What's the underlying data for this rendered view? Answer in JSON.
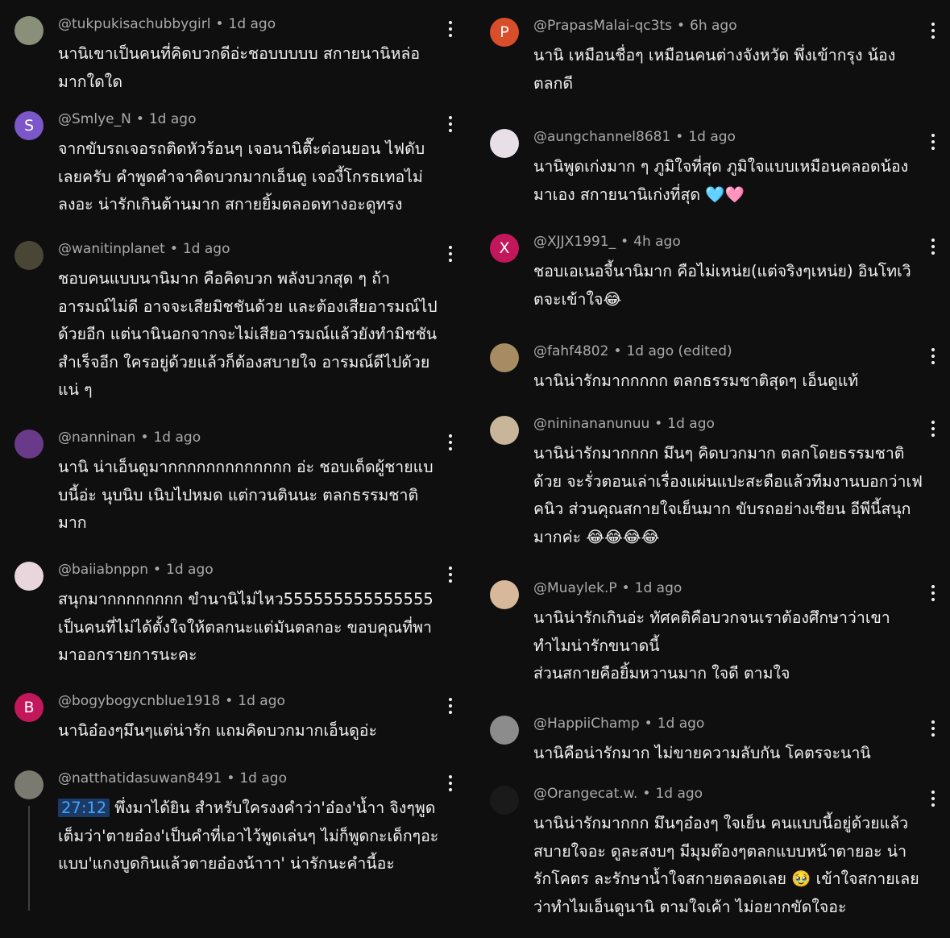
{
  "left": [
    {
      "handle": "@tukpukisachubbygirl",
      "time": "1d ago",
      "avatar": {
        "type": "image",
        "color": "#8a8f7a"
      },
      "text": "นานิเขาเป็นคนที่คิดบวกดีอ่ะชอบบบบบ สกายนานิหล่อมากใดใด"
    },
    {
      "handle": "@Smlye_N",
      "time": "1d ago",
      "avatar": {
        "type": "letter",
        "letter": "S",
        "color": "#7b57c9"
      },
      "text": "จากขับรถเจอรถติดหัวร้อนๆ เจอนานิตื๊ะต่อนยอน ไฟดับเลยครับ คำพูดคำจาคิดบวกมากเอ็นดู เจองี้โกรธเทอไม่ลงอะ น่ารักเกินต้านมาก สกายยิ้มตลอดทางอะดูทรง"
    },
    {
      "handle": "@wanitinplanet",
      "time": "1d ago",
      "avatar": {
        "type": "image",
        "color": "#4a4636"
      },
      "text": "ชอบคนแบบนานิมาก คือคิดบวก พลังบวกสุด ๆ ถ้าอารมณ์ไม่ดี อาจจะเสียมิชชันด้วย และต้องเสียอารมณ์ไปด้วยอีก แต่นานินอกจากจะไม่เสียอารมณ์แล้วยังทำมิชชันสำเร็จอีก ใครอยู่ด้วยแล้วก็ต้องสบายใจ อารมณ์ดีไปด้วยแน่ ๆ"
    },
    {
      "handle": "@nanninan",
      "time": "1d ago",
      "avatar": {
        "type": "image",
        "color": "#6a3a8a"
      },
      "text": "นานิ น่าเอ็นดูมากกกกกกกกกกกกก อ่ะ ชอบเด็ดผู้ชายแบบนี้อ่ะ นุบนิบ เนิบไปหมด แต่กวนตินนะ ตลกธรรมชาติมาก"
    },
    {
      "handle": "@baiiabnppn",
      "time": "1d ago",
      "avatar": {
        "type": "image",
        "color": "#e8d6dc"
      },
      "text": "สนุกมากกกกกกกก ขำนานิไม่ไหว555555555555555 เป็นคนที่ไม่ได้ตั้งใจให้ตลกนะแต่มันตลกอะ ขอบคุณที่พามาออกรายการนะคะ"
    },
    {
      "handle": "@bogybogycnblue1918",
      "time": "1d ago",
      "avatar": {
        "type": "letter",
        "letter": "B",
        "color": "#c2185b"
      },
      "text": "นานิอ๋องๆมึนๆแต่น่ารัก แถมคิดบวกมากเอ็นดูอ่ะ"
    },
    {
      "handle": "@natthatidasuwan8491",
      "time": "1d ago",
      "avatar": {
        "type": "image",
        "color": "#7a7a70"
      },
      "timestamp": "27:12",
      "text": "พึ่งมาได้ยิน สำหรับใครงงคำว่า'อ๋อง'น้ำา จิงๆพูดเต็มว่า'ตายอ๋อง'เป็นคำที่เอาไว้พูดเล่นๆ ไม่ก็พูดกะเด็กๆอะแบบ'แกงบูดกินแล้วตายอ๋องน้าาา' น่ารักนะคำนี้อะ"
    }
  ],
  "right": [
    {
      "handle": "@PrapasMalai-qc3ts",
      "time": "6h ago",
      "avatar": {
        "type": "letter",
        "letter": "P",
        "color": "#d84e2b"
      },
      "text": "นานิ เหมือนชื่อๆ เหมือนคนต่างจังหวัด พึ่งเข้ากรุง  น้องตลกดี"
    },
    {
      "handle": "@aungchannel8681",
      "time": "1d ago",
      "avatar": {
        "type": "image",
        "color": "#e8e0e6"
      },
      "text": "นานิพูดเก่งมาก ๆ ภูมิใจที่สุด ภูมิใจแบบเหมือนคลอดน้องมาเอง สกายนานิเก่งที่สุด 🩵🩷"
    },
    {
      "handle": "@XJJX1991_",
      "time": "4h ago",
      "avatar": {
        "type": "letter",
        "letter": "X",
        "color": "#c2185b"
      },
      "text": "ชอบเอเนอจี้นานิมาก คือไม่เหน่ย(แต่จริงๆเหน่ย) อินโทเวิตจะเข้าใจ😂"
    },
    {
      "handle": "@fahf4802",
      "time": "1d ago (edited)",
      "avatar": {
        "type": "image",
        "color": "#a68b63"
      },
      "text": "นานิน่ารักมากกกกก ตลกธรรมชาติสุดๆ เอ็นดูแท้"
    },
    {
      "handle": "@nininananunuu",
      "time": "1d ago",
      "avatar": {
        "type": "image",
        "color": "#c9b59a"
      },
      "text": "นานิน่ารักมากกกก มึนๆ คิดบวกมาก ตลกโดยธรรมชาติด้วย จะรั่วตอนเล่าเรื่องแผ่นแปะสะดือแล้วทีมงานบอกว่าเฟคนิว ส่วนคุณสกายใจเย็นมาก ขับรถอย่างเซียน อีพีนี้สนุกมากค่ะ 😂😂😂😂"
    },
    {
      "handle": "@Muaylek.P",
      "time": "1d ago",
      "avatar": {
        "type": "image",
        "color": "#d8b89a"
      },
      "text": "นานิน่ารักเกินอ่ะ ทัศคติคือบวกจนเราต้องศึกษาว่าเขาทำไมน่ารักขนาดนี้\nส่วนสกายคือยิ้มหวานมาก ใจดี ตามใจ"
    },
    {
      "handle": "@HappiiChamp",
      "time": "1d ago",
      "avatar": {
        "type": "image",
        "color": "#8c8c8c"
      },
      "text": "นานิคือน่ารักมาก ไม่ขายความลับกัน โคตรจะนานิ"
    },
    {
      "handle": "@Orangecat.w.",
      "time": "1d ago",
      "avatar": {
        "type": "image",
        "color": "#1a1a1a"
      },
      "text": "นานิน่ารักมากกก มึนๆอ๋องๆ ใจเย็น คนแบบนี้อยู่ด้วยแล้วสบายใจอะ ดูละสงบๆ มีมุมต๊องๆตลกแบบหน้าตายอะ น่ารักโคตร ละรักษาน้ำใจสกายตลอดเลย 🥹 เข้าใจสกายเลยว่าทำไมเอ็นดูนานิ ตามใจเค้า ไม่อยากขัดใจอะ"
    }
  ]
}
